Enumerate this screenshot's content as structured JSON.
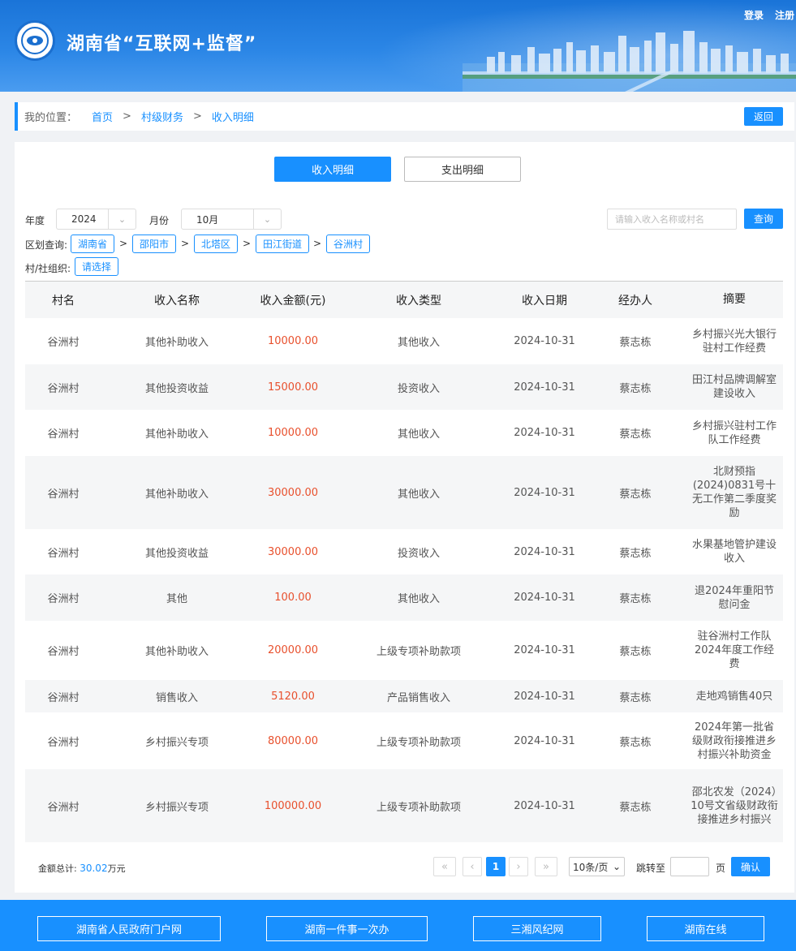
{
  "header": {
    "site_title": "湖南省“互联网+监督”",
    "login": "登录",
    "register": "注册"
  },
  "breadcrumb": {
    "label": "我的位置：",
    "items": [
      "首页",
      "村级财务",
      "收入明细"
    ],
    "separator": ">",
    "back": "返回"
  },
  "tabs": [
    "收入明细",
    "支出明细"
  ],
  "filters": {
    "year_label": "年度",
    "year_value": "2024",
    "month_label": "月份",
    "month_value": "10月",
    "search_placeholder": "请输入收入名称或村名",
    "query_label": "查询",
    "region_label": "区划查询:",
    "regions": [
      "湖南省",
      "邵阳市",
      "北塔区",
      "田江街道",
      "谷洲村"
    ],
    "region_separator": ">",
    "org_label": "村/社组织:",
    "org_button": "请选择"
  },
  "table": {
    "columns": [
      "村名",
      "收入名称",
      "收入金额(元)",
      "收入类型",
      "收入日期",
      "经办人",
      "摘要"
    ],
    "rows": [
      {
        "village": "谷洲村",
        "name": "其他补助收入",
        "amount": "10000.00",
        "type": "其他收入",
        "date": "2024-10-31",
        "handler": "蔡志栋",
        "summary": "乡村振兴光大银行驻村工作经费"
      },
      {
        "village": "谷洲村",
        "name": "其他投资收益",
        "amount": "15000.00",
        "type": "投资收入",
        "date": "2024-10-31",
        "handler": "蔡志栋",
        "summary": "田江村品牌调解室建设收入"
      },
      {
        "village": "谷洲村",
        "name": "其他补助收入",
        "amount": "10000.00",
        "type": "其他收入",
        "date": "2024-10-31",
        "handler": "蔡志栋",
        "summary": "乡村振兴驻村工作队工作经费"
      },
      {
        "village": "谷洲村",
        "name": "其他补助收入",
        "amount": "30000.00",
        "type": "其他收入",
        "date": "2024-10-31",
        "handler": "蔡志栋",
        "summary": "北财预指(2024)0831号十无工作第二季度奖励"
      },
      {
        "village": "谷洲村",
        "name": "其他投资收益",
        "amount": "30000.00",
        "type": "投资收入",
        "date": "2024-10-31",
        "handler": "蔡志栋",
        "summary": "水果基地管护建设收入"
      },
      {
        "village": "谷洲村",
        "name": "其他",
        "amount": "100.00",
        "type": "其他收入",
        "date": "2024-10-31",
        "handler": "蔡志栋",
        "summary": "退2024年重阳节慰问金"
      },
      {
        "village": "谷洲村",
        "name": "其他补助收入",
        "amount": "20000.00",
        "type": "上级专项补助款项",
        "date": "2024-10-31",
        "handler": "蔡志栋",
        "summary": "驻谷洲村工作队2024年度工作经费"
      },
      {
        "village": "谷洲村",
        "name": "销售收入",
        "amount": "5120.00",
        "type": "产品销售收入",
        "date": "2024-10-31",
        "handler": "蔡志栋",
        "summary": "走地鸡销售40只"
      },
      {
        "village": "谷洲村",
        "name": "乡村振兴专项",
        "amount": "80000.00",
        "type": "上级专项补助款项",
        "date": "2024-10-31",
        "handler": "蔡志栋",
        "summary": "2024年第一批省级财政衔接推进乡村振兴补助资金"
      },
      {
        "village": "谷洲村",
        "name": "乡村振兴专项",
        "amount": "100000.00",
        "type": "上级专项补助款项",
        "date": "2024-10-31",
        "handler": "蔡志栋",
        "summary": "邵北农发（2024）10号文省级财政衔接推进乡村振兴"
      }
    ]
  },
  "summary": {
    "total_label": "金额总计:",
    "total_value": "30.02",
    "total_unit": "万元"
  },
  "pagination": {
    "first": "«",
    "prev": "‹",
    "current": "1",
    "next": "›",
    "last": "»",
    "page_size": "10条/页",
    "jump_label": "跳转至",
    "page_unit": "页",
    "confirm": "确认"
  },
  "footer": {
    "links": [
      "湖南省人民政府门户网",
      "湖南一件事一次办",
      "三湘风纪网",
      "湖南在线"
    ]
  },
  "colors": {
    "primary": "#1890ff",
    "amount": "#e8502d",
    "header": "#1a74d8"
  }
}
